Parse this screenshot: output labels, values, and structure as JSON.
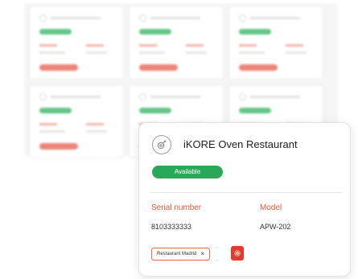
{
  "detail": {
    "title": "iKORE Oven Restaurant",
    "status": "Available",
    "fields": {
      "serial_label": "Serial number",
      "serial_value": "8103333333",
      "model_label": "Model",
      "model_value": "APW-202"
    },
    "tag": {
      "label": "Restaurant Madrid",
      "remove": "×"
    },
    "icons": {
      "device": "oven-device-icon",
      "settings": "gear-icon"
    }
  },
  "colors": {
    "available_green": "#2aa85a",
    "label_orange": "#e25b3e",
    "action_red": "#e23a2f",
    "tag_border": "#e46a52"
  }
}
